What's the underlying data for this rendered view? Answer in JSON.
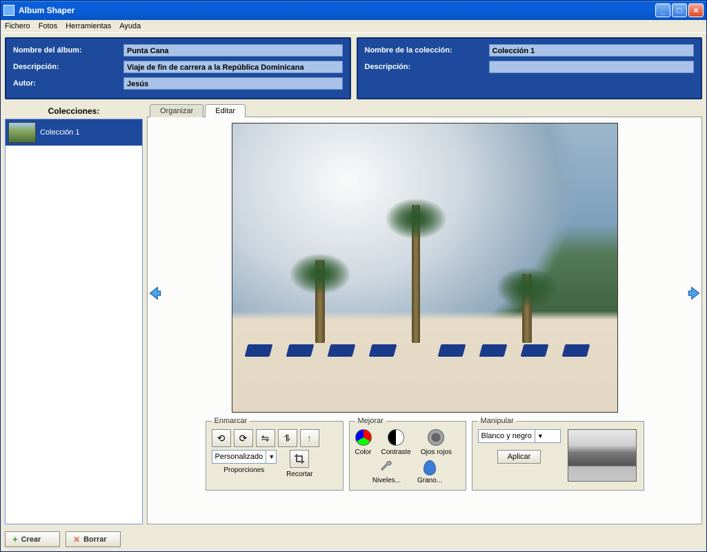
{
  "window": {
    "title": "Album Shaper"
  },
  "menu": {
    "items": [
      "Fichero",
      "Fotos",
      "Herramientas",
      "Ayuda"
    ]
  },
  "album_panel": {
    "name_label": "Nombre del álbum:",
    "name_value": "Punta Cana",
    "desc_label": "Descripción:",
    "desc_value": "Viaje de fin de carrera a la República Dominicana",
    "author_label": "Autor:",
    "author_value": "Jesús"
  },
  "collection_panel": {
    "name_label": "Nombre de la colección:",
    "name_value": "Colección 1",
    "desc_label": "Descripción:",
    "desc_value": ""
  },
  "sidebar": {
    "header": "Colecciones:",
    "items": [
      {
        "label": "Colección 1"
      }
    ]
  },
  "tabs": {
    "organizar": "Organizar",
    "editar": "Editar",
    "active": "editar"
  },
  "enmarcar": {
    "legend": "Enmarcar",
    "select": "Personalizado",
    "proporciones": "Proporciones",
    "recortar": "Recortar"
  },
  "mejorar": {
    "legend": "Mejorar",
    "color": "Color",
    "contraste": "Contraste",
    "ojos": "Ojos rojos",
    "niveles": "Niveles...",
    "grano": "Grano..."
  },
  "manipular": {
    "legend": "Manipular",
    "select": "Blanco y negro",
    "aplicar": "Aplicar"
  },
  "bottom": {
    "crear": "Crear",
    "borrar": "Borrar"
  }
}
